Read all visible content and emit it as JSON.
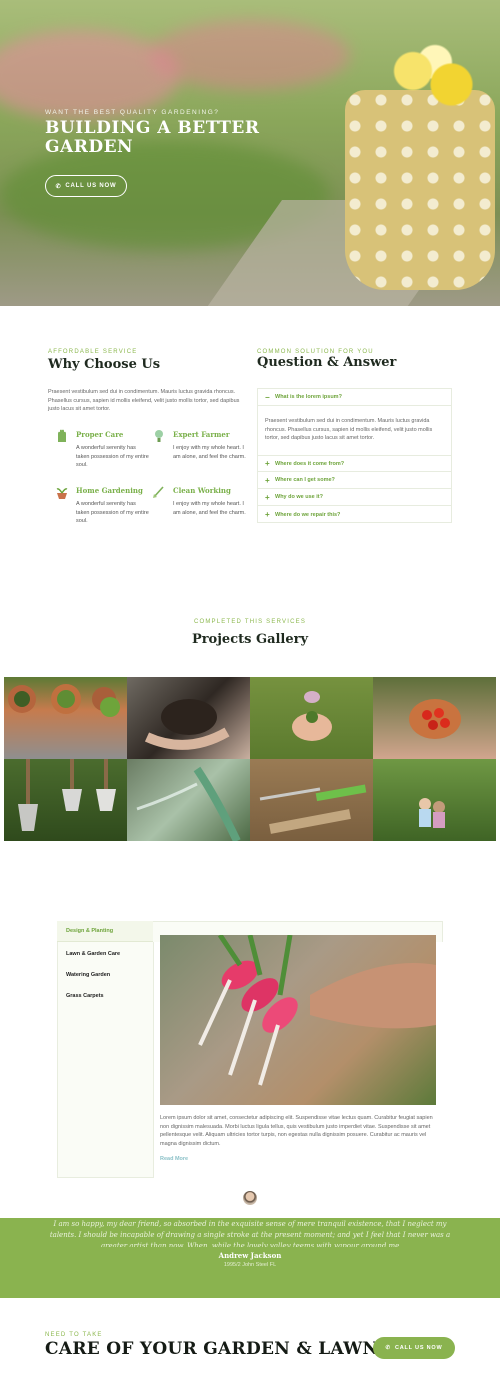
{
  "hero": {
    "subtitle": "WANT THE BEST QUALITY GARDENING?",
    "title": "BUILDING A BETTER GARDEN",
    "button": "CALL US NOW",
    "button_icon": "phone-icon"
  },
  "why": {
    "kicker": "AFFORDABLE SERVICE",
    "title": "Why Choose Us",
    "text": "Praesent vestibulum sed dui in condimentum. Mauris luctus gravida rhoncus. Phasellus cursus, sapien id mollis eleifend, velit justo mollis tortor, sed dapibus justo lacus sit amet tortor.",
    "features": [
      {
        "title": "Proper Care",
        "text": "A wonderful serenity has taken possession of my entire soul.",
        "icon": "glove-icon"
      },
      {
        "title": "Expert Farmer",
        "text": "I enjoy with my whole heart. I am alone, and feel the charm.",
        "icon": "bulb-icon"
      },
      {
        "title": "Home Gardening",
        "text": "A wonderful serenity has taken possession of my entire soul.",
        "icon": "plant-pot-icon"
      },
      {
        "title": "Clean Working",
        "text": "I enjoy with my whole heart. I am alone, and feel the charm.",
        "icon": "shovel-icon"
      }
    ]
  },
  "qa": {
    "kicker": "COMMON SOLUTION FOR YOU",
    "title": "Question & Answer",
    "items": [
      {
        "question": "What is the lorem ipsum?",
        "answer": "Praesent vestibulum sed dui in condimentum. Mauris luctus gravida rhoncus. Phasellus cursus, sapien id mollis eleifend, velit justo mollis tortor, sed dapibus justo lacus sit amet tortor."
      },
      {
        "question": "Where does it come from?"
      },
      {
        "question": "Where can I get some?"
      },
      {
        "question": "Why do we use it?"
      },
      {
        "question": "Where do we repair this?"
      }
    ]
  },
  "gallery": {
    "kicker": "COMPLETED THIS SERVICES",
    "title": "Projects Gallery",
    "tiles": [
      "potted-plants",
      "hands-with-soil",
      "hands-with-seedling",
      "hands-with-tomatoes",
      "garden-spades",
      "watering-hose",
      "rake-and-boots",
      "children-in-garden"
    ]
  },
  "tabs": {
    "items": [
      "Design & Planting",
      "Lawn & Garden Care",
      "Watering Garden",
      "Grass Carpets"
    ],
    "active": "Design & Planting",
    "panel_text": "Lorem ipsum dolor sit amet, consectetur adipiscing elit. Suspendisse vitae lectus quam. Curabitur feugiat sapien non dignissim malesuada. Morbi luctus ligula tellus, quis vestibulum justo imperdiet vitae. Suspendisse sit amet pellentesque velit. Aliquam ultricies tortor turpis, non egestas nulla dignissim posuere. Curabitur ac mauris vel magna dignissim dictum.",
    "read_more": "Read More"
  },
  "testimonial": {
    "quote": "I am so happy, my dear friend, so absorbed in the exquisite sense of mere tranquil existence, that I neglect my talents. I should be incapable of drawing a single stroke at the present moment; and yet I feel that I never was a greater artist than now. When, while the lovely valley teems with vapour around me",
    "name": "Andrew Jackson",
    "role": "1995/2 John Steel FL"
  },
  "cta": {
    "kicker": "NEED TO TAKE",
    "title": "CARE OF YOUR GARDEN & LAWN",
    "button": "CALL US NOW"
  },
  "colors": {
    "accent": "#8ab34f",
    "accent_dark": "#6ea43b",
    "heading": "#1f2a1f"
  }
}
